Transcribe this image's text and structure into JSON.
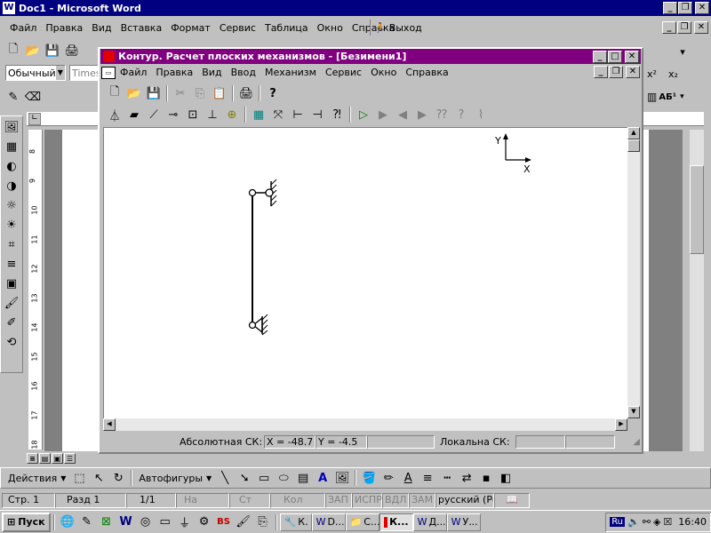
{
  "word": {
    "title": "Doc1 - Microsoft Word",
    "title_icon": "W",
    "menu": [
      "Файл",
      "Правка",
      "Вид",
      "Вставка",
      "Формат",
      "Сервис",
      "Таблица",
      "Окно",
      "Справка"
    ],
    "exit_label": "Выход",
    "style_value": "Обычный",
    "font_value": "Times",
    "ruler_marks": [
      "8",
      "9",
      "10",
      "11",
      "12",
      "13",
      "14",
      "15",
      "16",
      "17",
      "18"
    ],
    "drawing": {
      "actions_label": "Действия",
      "autoshapes_label": "Автофигуры"
    },
    "status": {
      "page": "Стр. 1",
      "section": "Разд 1",
      "pages": "1/1",
      "at": "На",
      "line": "Ст",
      "col": "Кол",
      "rec": "ЗАП",
      "trk": "ИСПР",
      "ext": "ВДЛ",
      "ovr": "ЗАМ",
      "lang": "русский (Ро"
    },
    "superscript": "x²",
    "subscript": "x₂",
    "style_btn": "АБ¹"
  },
  "contour": {
    "title": "Контур. Расчет плоских механизмов - [Безимени1]",
    "menu": [
      "Файл",
      "Правка",
      "Вид",
      "Ввод",
      "Механизм",
      "Сервис",
      "Окно",
      "Справка"
    ],
    "axis_x": "X",
    "axis_y": "Y",
    "status": {
      "abs_label": "Абсолютная СК:",
      "x_value": "X = -48.7",
      "y_value": "Y = -4.5",
      "local_label": "Локальна СК:"
    }
  },
  "taskbar": {
    "start_label": "Пуск",
    "tasks": [
      "К...",
      "D...",
      "C...",
      "К...",
      "Д...",
      "У..."
    ],
    "lang": "Ru",
    "clock": "16:40"
  },
  "colors": {
    "word_title": "#000080",
    "contour_title": "#800080",
    "face": "#c0c0c0"
  }
}
